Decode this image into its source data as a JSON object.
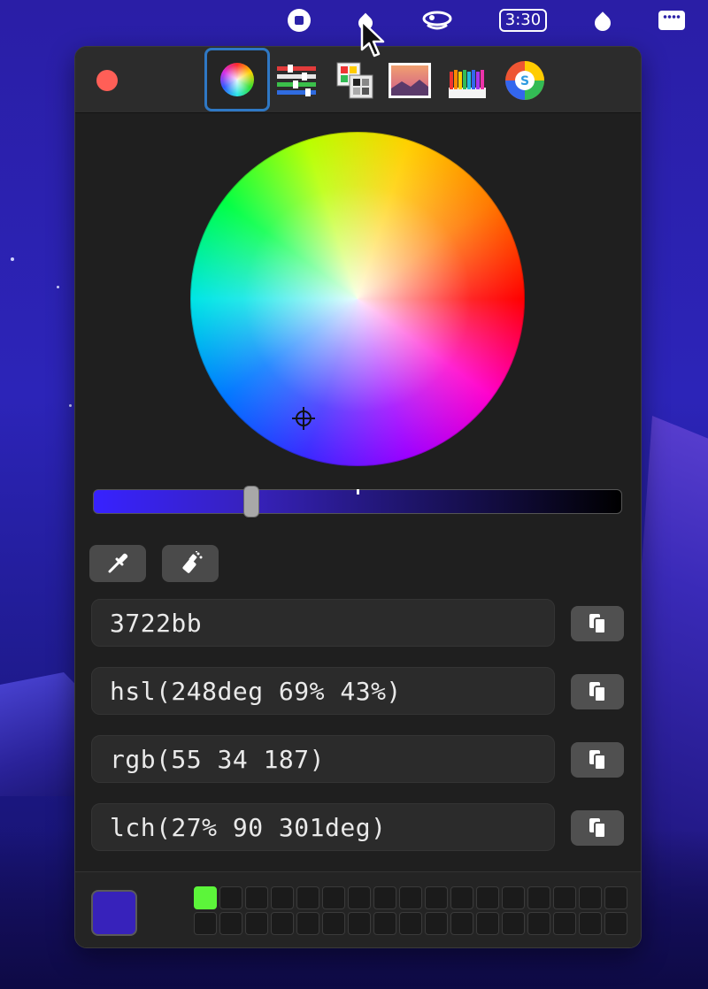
{
  "menubar": {
    "clock": "3:30",
    "icons": [
      "stop-recording-icon",
      "color-picker-drop-icon",
      "cloud-sync-icon",
      "clock-battery-icon",
      "drop-icon",
      "control-strip-icon"
    ]
  },
  "toolbar": {
    "tabs": [
      {
        "name": "color-wheel-tab",
        "icon": "color-wheel-icon",
        "selected": true
      },
      {
        "name": "color-sliders-tab",
        "icon": "sliders-icon",
        "selected": false
      },
      {
        "name": "color-palettes-tab",
        "icon": "palettes-icon",
        "selected": false
      },
      {
        "name": "image-palettes-tab",
        "icon": "image-icon",
        "selected": false
      },
      {
        "name": "pencils-tab",
        "icon": "pencils-icon",
        "selected": false
      },
      {
        "name": "spectrum-tab",
        "icon": "spectrum-icon",
        "selected": false
      }
    ]
  },
  "brightness": {
    "level": 0.3
  },
  "tools": {
    "eyedropper": "eyedropper-icon",
    "sprayer": "sprayer-icon"
  },
  "formats": {
    "hex": "3722bb",
    "hsl": "hsl(248deg 69% 43%)",
    "rgb": "rgb(55 34 187)",
    "lch": "lch(27% 90 301deg)"
  },
  "current_color": "#3722bb",
  "history": {
    "first_color": "#5cf53a",
    "rows": 2,
    "columns": 17
  },
  "colors": {
    "accent": "#2f78c4",
    "close": "#ff5f57",
    "panel": "#1f1f1f"
  }
}
